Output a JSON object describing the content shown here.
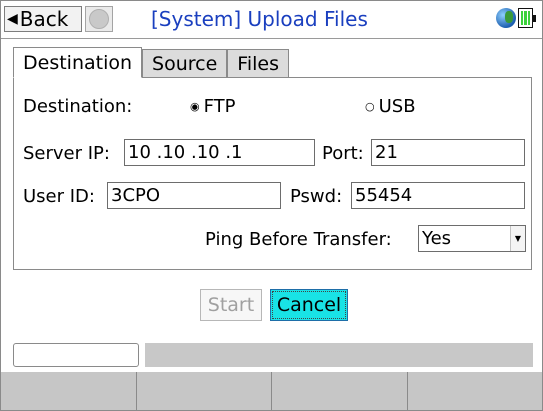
{
  "titlebar": {
    "back_label": "Back",
    "title": "[System] Upload Files"
  },
  "tabs": [
    {
      "label": "Destination",
      "active": true
    },
    {
      "label": "Source",
      "active": false
    },
    {
      "label": "Files",
      "active": false
    }
  ],
  "form": {
    "destination_label": "Destination:",
    "options": [
      {
        "label": "FTP",
        "selected": true
      },
      {
        "label": "USB",
        "selected": false
      }
    ],
    "server_ip_label": "Server IP:",
    "server_ip_value": "10 .10 .10 .1",
    "port_label": "Port:",
    "port_value": "21",
    "user_id_label": "User ID:",
    "user_id_value": "3CPO",
    "pswd_label": "Pswd:",
    "pswd_value": "55454",
    "ping_label": "Ping Before Transfer:",
    "ping_value": "Yes"
  },
  "buttons": {
    "start_label": "Start",
    "cancel_label": "Cancel"
  },
  "icons": {
    "back": "left-triangle-icon",
    "refresh": "refresh-icon",
    "network": "globe-icon",
    "battery": "battery-icon"
  },
  "colors": {
    "title": "#1a3fbf",
    "cancel_bg": "#19e3e6",
    "battery": "#3cd23c"
  }
}
